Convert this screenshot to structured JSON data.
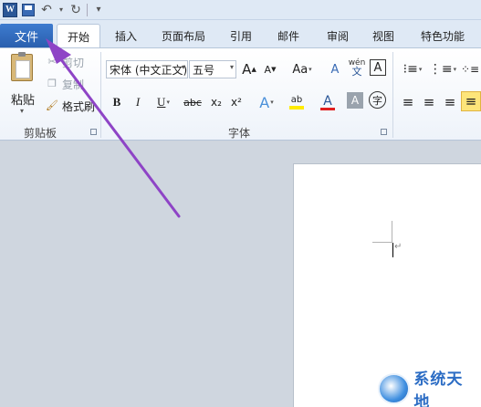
{
  "qat": {
    "word_logo": "W",
    "undo_glyph": "↶",
    "redo_glyph": "↻",
    "customize_glyph": "▾"
  },
  "tabs": {
    "file": "文件",
    "home": "开始",
    "insert": "插入",
    "page_layout": "页面布局",
    "references": "引用",
    "mailings": "邮件",
    "review": "审阅",
    "view": "视图",
    "special": "特色功能"
  },
  "clipboard": {
    "paste": "粘贴",
    "cut": "剪切",
    "copy": "复制",
    "format_painter": "格式刷",
    "group_label": "剪贴板"
  },
  "font": {
    "font_name": "宋体 (中文正文)",
    "font_size": "五号",
    "grow": "A",
    "shrink": "A",
    "change_case": "Aa",
    "clear_format": "A",
    "phonetic": "wén",
    "char_border": "A",
    "bold": "B",
    "italic": "I",
    "underline": "U",
    "strikethrough": "abc",
    "subscript": "x₂",
    "superscript": "x²",
    "text_effect": "A",
    "highlight": "ab",
    "font_color": "A",
    "char_shading": "A",
    "enclose": "字",
    "group_label": "字体"
  },
  "colors": {
    "file_tab": "#2a5fae",
    "arrow": "#8e44c6",
    "highlight": "#ffeb00",
    "font_color": "#e02020"
  },
  "watermark": {
    "text": "系统天地"
  }
}
